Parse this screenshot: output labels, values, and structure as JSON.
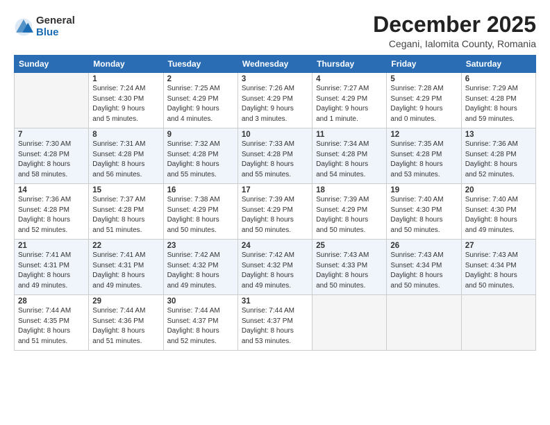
{
  "logo": {
    "general": "General",
    "blue": "Blue"
  },
  "title": "December 2025",
  "subtitle": "Cegani, Ialomita County, Romania",
  "weekdays": [
    "Sunday",
    "Monday",
    "Tuesday",
    "Wednesday",
    "Thursday",
    "Friday",
    "Saturday"
  ],
  "weeks": [
    [
      {
        "day": "",
        "info": ""
      },
      {
        "day": "1",
        "info": "Sunrise: 7:24 AM\nSunset: 4:30 PM\nDaylight: 9 hours\nand 5 minutes."
      },
      {
        "day": "2",
        "info": "Sunrise: 7:25 AM\nSunset: 4:29 PM\nDaylight: 9 hours\nand 4 minutes."
      },
      {
        "day": "3",
        "info": "Sunrise: 7:26 AM\nSunset: 4:29 PM\nDaylight: 9 hours\nand 3 minutes."
      },
      {
        "day": "4",
        "info": "Sunrise: 7:27 AM\nSunset: 4:29 PM\nDaylight: 9 hours\nand 1 minute."
      },
      {
        "day": "5",
        "info": "Sunrise: 7:28 AM\nSunset: 4:29 PM\nDaylight: 9 hours\nand 0 minutes."
      },
      {
        "day": "6",
        "info": "Sunrise: 7:29 AM\nSunset: 4:28 PM\nDaylight: 8 hours\nand 59 minutes."
      }
    ],
    [
      {
        "day": "7",
        "info": "Sunrise: 7:30 AM\nSunset: 4:28 PM\nDaylight: 8 hours\nand 58 minutes."
      },
      {
        "day": "8",
        "info": "Sunrise: 7:31 AM\nSunset: 4:28 PM\nDaylight: 8 hours\nand 56 minutes."
      },
      {
        "day": "9",
        "info": "Sunrise: 7:32 AM\nSunset: 4:28 PM\nDaylight: 8 hours\nand 55 minutes."
      },
      {
        "day": "10",
        "info": "Sunrise: 7:33 AM\nSunset: 4:28 PM\nDaylight: 8 hours\nand 55 minutes."
      },
      {
        "day": "11",
        "info": "Sunrise: 7:34 AM\nSunset: 4:28 PM\nDaylight: 8 hours\nand 54 minutes."
      },
      {
        "day": "12",
        "info": "Sunrise: 7:35 AM\nSunset: 4:28 PM\nDaylight: 8 hours\nand 53 minutes."
      },
      {
        "day": "13",
        "info": "Sunrise: 7:36 AM\nSunset: 4:28 PM\nDaylight: 8 hours\nand 52 minutes."
      }
    ],
    [
      {
        "day": "14",
        "info": "Sunrise: 7:36 AM\nSunset: 4:28 PM\nDaylight: 8 hours\nand 52 minutes."
      },
      {
        "day": "15",
        "info": "Sunrise: 7:37 AM\nSunset: 4:28 PM\nDaylight: 8 hours\nand 51 minutes."
      },
      {
        "day": "16",
        "info": "Sunrise: 7:38 AM\nSunset: 4:29 PM\nDaylight: 8 hours\nand 50 minutes."
      },
      {
        "day": "17",
        "info": "Sunrise: 7:39 AM\nSunset: 4:29 PM\nDaylight: 8 hours\nand 50 minutes."
      },
      {
        "day": "18",
        "info": "Sunrise: 7:39 AM\nSunset: 4:29 PM\nDaylight: 8 hours\nand 50 minutes."
      },
      {
        "day": "19",
        "info": "Sunrise: 7:40 AM\nSunset: 4:30 PM\nDaylight: 8 hours\nand 50 minutes."
      },
      {
        "day": "20",
        "info": "Sunrise: 7:40 AM\nSunset: 4:30 PM\nDaylight: 8 hours\nand 49 minutes."
      }
    ],
    [
      {
        "day": "21",
        "info": "Sunrise: 7:41 AM\nSunset: 4:31 PM\nDaylight: 8 hours\nand 49 minutes."
      },
      {
        "day": "22",
        "info": "Sunrise: 7:41 AM\nSunset: 4:31 PM\nDaylight: 8 hours\nand 49 minutes."
      },
      {
        "day": "23",
        "info": "Sunrise: 7:42 AM\nSunset: 4:32 PM\nDaylight: 8 hours\nand 49 minutes."
      },
      {
        "day": "24",
        "info": "Sunrise: 7:42 AM\nSunset: 4:32 PM\nDaylight: 8 hours\nand 49 minutes."
      },
      {
        "day": "25",
        "info": "Sunrise: 7:43 AM\nSunset: 4:33 PM\nDaylight: 8 hours\nand 50 minutes."
      },
      {
        "day": "26",
        "info": "Sunrise: 7:43 AM\nSunset: 4:34 PM\nDaylight: 8 hours\nand 50 minutes."
      },
      {
        "day": "27",
        "info": "Sunrise: 7:43 AM\nSunset: 4:34 PM\nDaylight: 8 hours\nand 50 minutes."
      }
    ],
    [
      {
        "day": "28",
        "info": "Sunrise: 7:44 AM\nSunset: 4:35 PM\nDaylight: 8 hours\nand 51 minutes."
      },
      {
        "day": "29",
        "info": "Sunrise: 7:44 AM\nSunset: 4:36 PM\nDaylight: 8 hours\nand 51 minutes."
      },
      {
        "day": "30",
        "info": "Sunrise: 7:44 AM\nSunset: 4:37 PM\nDaylight: 8 hours\nand 52 minutes."
      },
      {
        "day": "31",
        "info": "Sunrise: 7:44 AM\nSunset: 4:37 PM\nDaylight: 8 hours\nand 53 minutes."
      },
      {
        "day": "",
        "info": ""
      },
      {
        "day": "",
        "info": ""
      },
      {
        "day": "",
        "info": ""
      }
    ]
  ]
}
